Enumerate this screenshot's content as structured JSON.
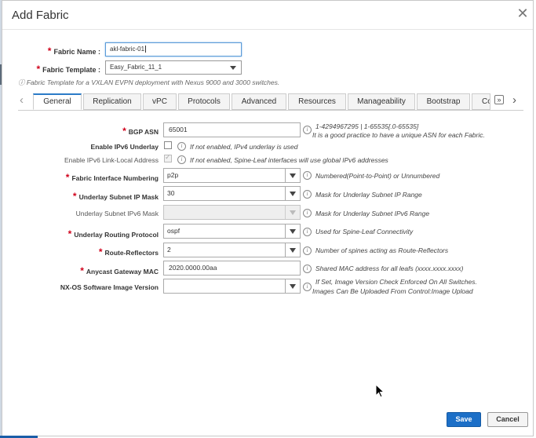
{
  "dialog": {
    "title": "Add Fabric",
    "close_icon": "close-icon"
  },
  "fabric_name": {
    "label": "Fabric Name :",
    "value": "akl-fabric-01"
  },
  "fabric_template": {
    "label": "Fabric Template :",
    "value": "Easy_Fabric_11_1",
    "note": "ⓘ Fabric Template for a VXLAN EVPN deployment with Nexus 9000 and 3000 switches."
  },
  "tabs": [
    {
      "label": "General",
      "active": true
    },
    {
      "label": "Replication"
    },
    {
      "label": "vPC"
    },
    {
      "label": "Protocols"
    },
    {
      "label": "Advanced"
    },
    {
      "label": "Resources"
    },
    {
      "label": "Manageability"
    },
    {
      "label": "Bootstrap"
    },
    {
      "label": "Co"
    }
  ],
  "fields": {
    "bgp_asn": {
      "label": "BGP ASN",
      "value": "65001",
      "hint_line1": "1-4294967295 | 1-65535[.0-65535]",
      "hint_line2": "It is a good practice to have a unique ASN for each Fabric."
    },
    "enable_ipv6_underlay": {
      "label": "Enable IPv6 Underlay",
      "hint": "If not enabled, IPv4 underlay is used"
    },
    "enable_ipv6_link_local": {
      "label": "Enable IPv6 Link-Local Address",
      "hint": "If not enabled, Spine-Leaf interfaces will use global IPv6 addresses"
    },
    "fabric_interface_numbering": {
      "label": "Fabric Interface Numbering",
      "value": "p2p",
      "hint": "Numbered(Point-to-Point) or Unnumbered"
    },
    "underlay_subnet_ip_mask": {
      "label": "Underlay Subnet IP Mask",
      "value": "30",
      "hint": "Mask for Underlay Subnet IP Range"
    },
    "underlay_subnet_ipv6_mask": {
      "label": "Underlay Subnet IPv6 Mask",
      "value": "",
      "hint": "Mask for Underlay Subnet IPv6 Range"
    },
    "underlay_routing_protocol": {
      "label": "Underlay Routing Protocol",
      "value": "ospf",
      "hint": "Used for Spine-Leaf Connectivity"
    },
    "route_reflectors": {
      "label": "Route-Reflectors",
      "value": "2",
      "hint": "Number of spines acting as Route-Reflectors"
    },
    "anycast_gateway_mac": {
      "label": "Anycast Gateway MAC",
      "value": "2020.0000.00aa",
      "hint": "Shared MAC address for all leafs (xxxx.xxxx.xxxx)"
    },
    "nxos_image_version": {
      "label": "NX-OS Software Image Version",
      "value": "",
      "hint_line1": "If Set, Image Version Check Enforced On All Switches.",
      "hint_line2": "Images Can Be Uploaded From Control:Image Upload"
    }
  },
  "info_glyph": "i",
  "footer": {
    "save_label": "Save",
    "cancel_label": "Cancel"
  },
  "colors": {
    "primary": "#1c6fc7",
    "required": "#d0021b",
    "active_tab": "#2b7bc7"
  }
}
